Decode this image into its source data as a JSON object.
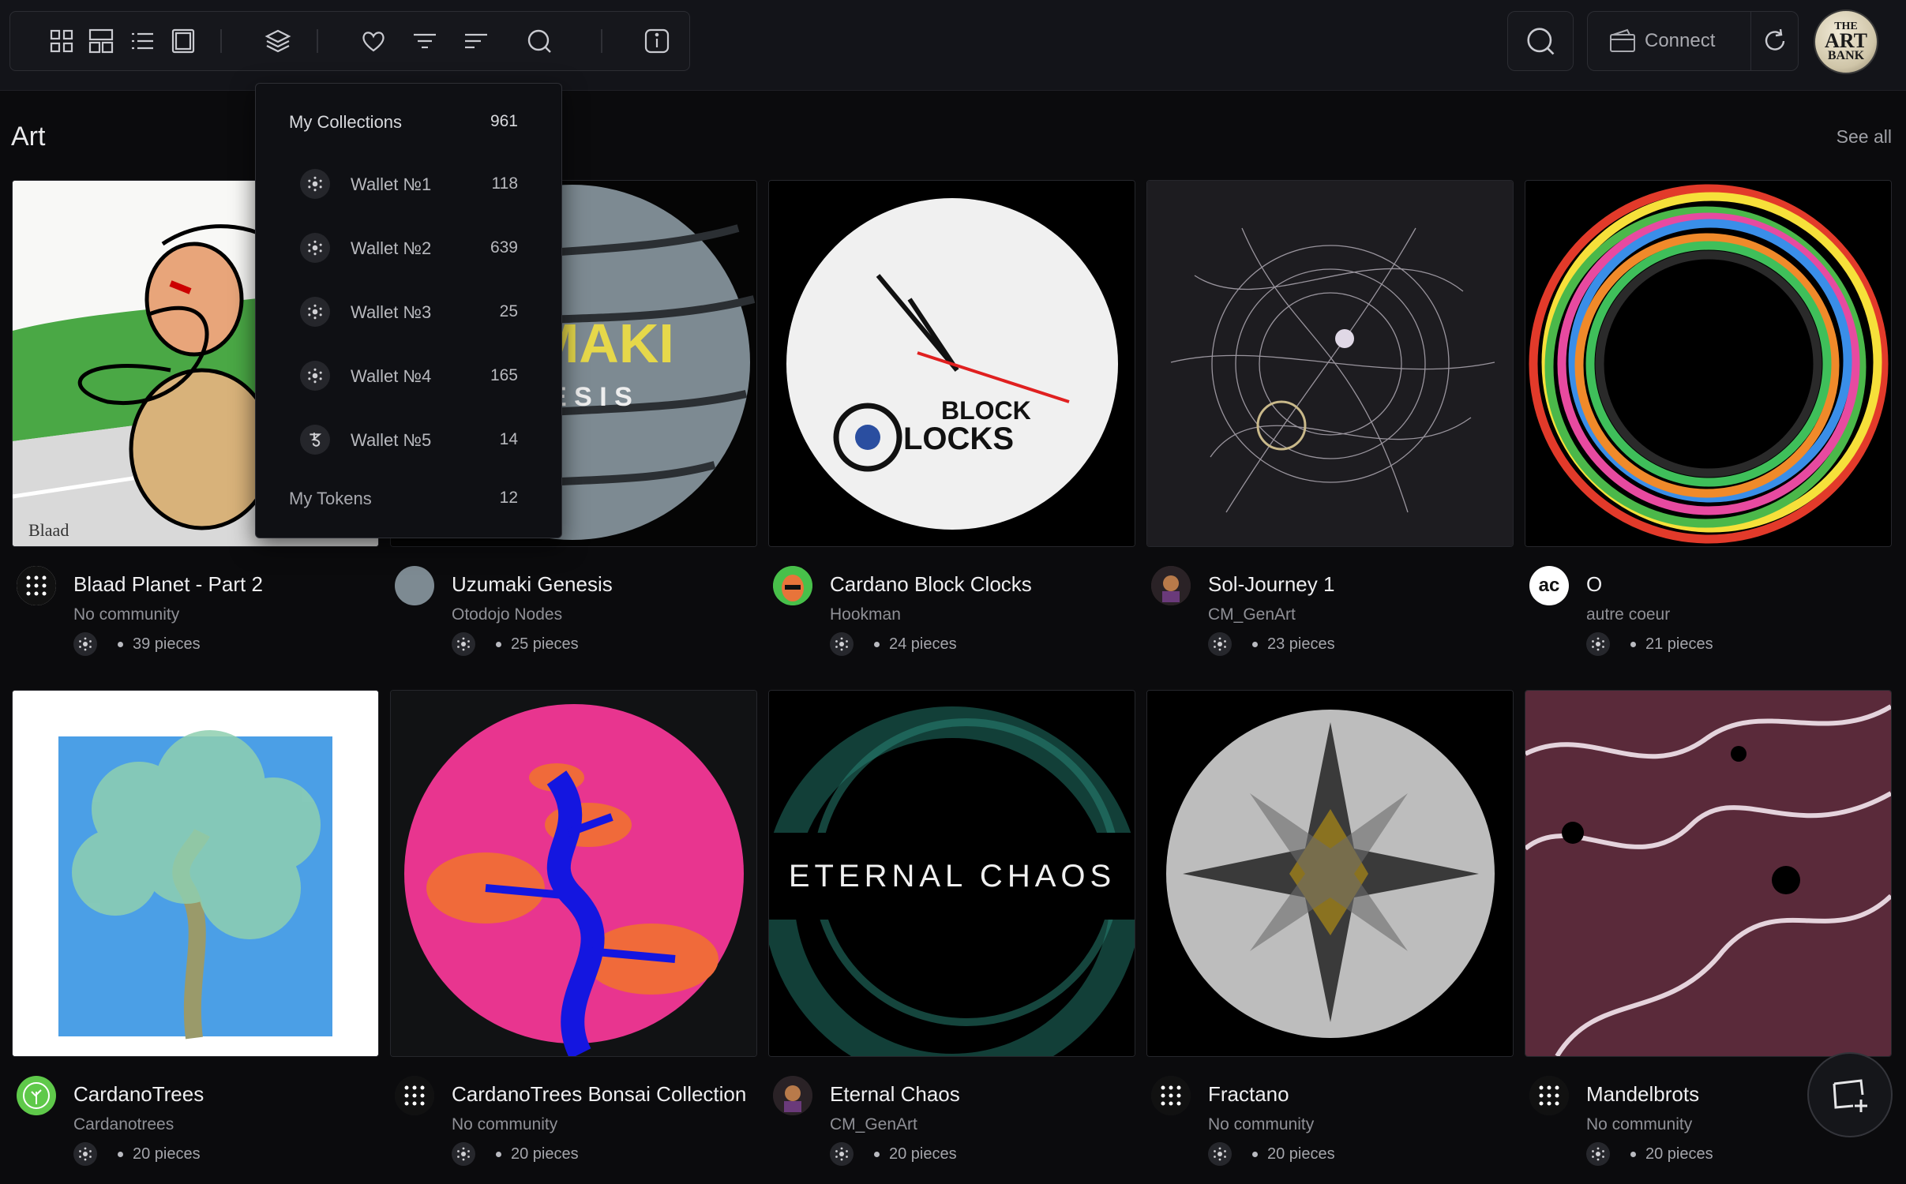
{
  "connect_label": "Connect",
  "logo": {
    "line1": "THE",
    "line2": "ART",
    "line3": "BANK"
  },
  "section": {
    "title": "Art",
    "see_all": "See all"
  },
  "dropdown": {
    "header": {
      "label": "My Collections",
      "count": "961"
    },
    "wallets": [
      {
        "label": "Wallet №1",
        "count": "118",
        "icon": "cardano-icon"
      },
      {
        "label": "Wallet №2",
        "count": "639",
        "icon": "cardano-icon"
      },
      {
        "label": "Wallet №3",
        "count": "25",
        "icon": "cardano-icon"
      },
      {
        "label": "Wallet №4",
        "count": "165",
        "icon": "cardano-icon"
      },
      {
        "label": "Wallet №5",
        "count": "14",
        "icon": "tezos-icon"
      }
    ],
    "tokens": {
      "label": "My Tokens",
      "count": "12"
    }
  },
  "cards": [
    {
      "title": "Blaad Planet - Part 2",
      "subtitle": "No community",
      "pieces": "39 pieces"
    },
    {
      "title": "Uzumaki Genesis",
      "subtitle": "Otodojo Nodes",
      "pieces": "25 pieces",
      "art_text": "MAKI",
      "art_text2": "E S I S"
    },
    {
      "title": "Cardano Block Clocks",
      "subtitle": "Hookman",
      "pieces": "24 pieces",
      "art_text": "BLOCK",
      "art_text2": "LOCKS"
    },
    {
      "title": "Sol-Journey 1",
      "subtitle": "CM_GenArt",
      "pieces": "23 pieces"
    },
    {
      "title": "O",
      "subtitle": "autre coeur",
      "pieces": "21 pieces",
      "avatar_text": "ac"
    },
    {
      "title": "CardanoTrees",
      "subtitle": "Cardanotrees",
      "pieces": "20 pieces"
    },
    {
      "title": "CardanoTrees Bonsai Collection",
      "subtitle": "No community",
      "pieces": "20 pieces"
    },
    {
      "title": "Eternal Chaos",
      "subtitle": "CM_GenArt",
      "pieces": "20 pieces",
      "art_text": "ETERNAL CHAOS"
    },
    {
      "title": "Fractano",
      "subtitle": "No community",
      "pieces": "20 pieces"
    },
    {
      "title": "Mandelbrots",
      "subtitle": "No community",
      "pieces": "20 pieces"
    }
  ]
}
